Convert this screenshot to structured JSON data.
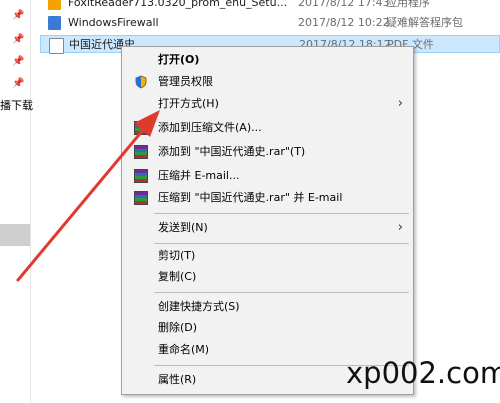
{
  "files": [
    {
      "name": "FoxitReader713.0320_prom_enu_Setu...",
      "date": "2017/8/12 17:43",
      "type": "应用程序",
      "icon": "foxit-setup-icon"
    },
    {
      "name": "WindowsFirewall",
      "date": "2017/8/12 10:22",
      "type": "疑难解答程序包",
      "icon": "troubleshooter-icon"
    },
    {
      "name": "中国近代通史",
      "date": "2017/8/12 18:12",
      "type": "PDF 文件",
      "icon": "pdf-file-icon"
    }
  ],
  "sidebar": {
    "fragment": "播下载"
  },
  "context_menu": {
    "open": "打开(O)",
    "run_as_admin": "管理员权限",
    "open_with": "打开方式(H)",
    "add_to_archive": "添加到压缩文件(A)...",
    "add_to_rar": "添加到 \"中国近代通史.rar\"(T)",
    "compress_email": "压缩并 E-mail...",
    "compress_rar_email": "压缩到 \"中国近代通史.rar\" 并 E-mail",
    "send_to": "发送到(N)",
    "cut": "剪切(T)",
    "copy": "复制(C)",
    "create_shortcut": "创建快捷方式(S)",
    "delete": "删除(D)",
    "rename": "重命名(M)",
    "properties": "属性(R)"
  },
  "watermark": "xp002.com",
  "colors": {
    "selection": "#cce8ff",
    "menu_bg": "#f2f2f2",
    "arrow": "#e03a2e"
  }
}
